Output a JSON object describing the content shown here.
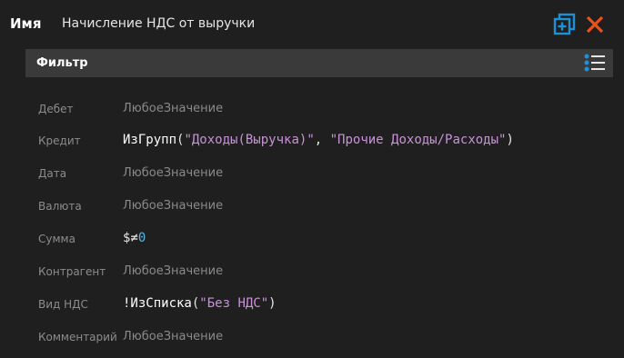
{
  "header": {
    "name_label": "Имя",
    "name_value": "Начисление НДС от выручки",
    "copy_icon": "copy-add-icon",
    "close_icon": "close-icon",
    "accent_blue": "#1e90d6",
    "accent_orange": "#e8531c"
  },
  "filter": {
    "title": "Фильтр",
    "menu_icon": "list-menu-icon",
    "rows": [
      {
        "label": "Дебет",
        "value": "ЛюбоеЗначение"
      },
      {
        "label": "Кредит",
        "fn": "ИзГрупп",
        "open": "(",
        "s1": "\"Доходы(Выручка)\"",
        "sep": ", ",
        "s2": "\"Прочие Доходы/Расходы\"",
        "close": ")"
      },
      {
        "label": "Дата",
        "value": "ЛюбоеЗначение"
      },
      {
        "label": "Валюта",
        "value": "ЛюбоеЗначение"
      },
      {
        "label": "Сумма",
        "op1": "$",
        "op2": "≠",
        "num": "0"
      },
      {
        "label": "Контрагент",
        "value": "ЛюбоеЗначение"
      },
      {
        "label": "Вид НДС",
        "fn": "!ИзСписка",
        "open": "(",
        "s1": "\"Без НДС\"",
        "close": ")"
      },
      {
        "label": "Комментарий",
        "value": "ЛюбоеЗначение"
      }
    ]
  }
}
